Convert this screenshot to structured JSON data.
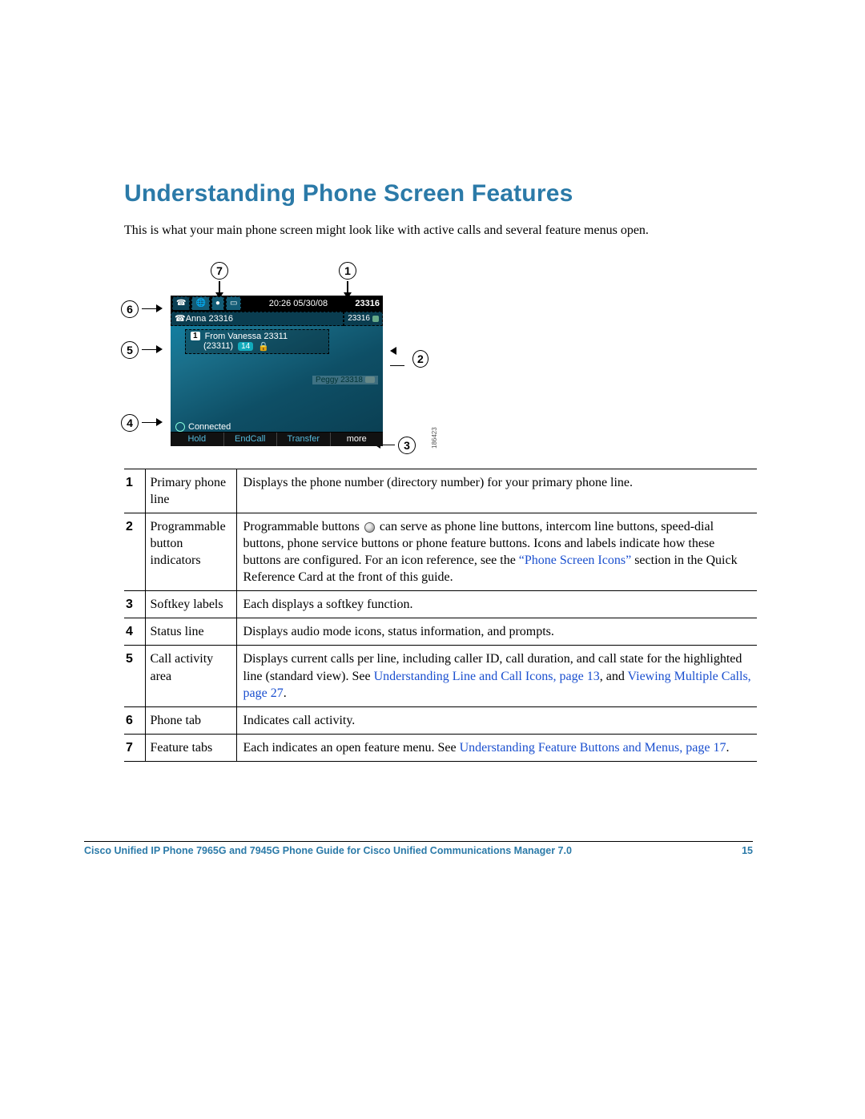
{
  "heading": "Understanding Phone Screen Features",
  "intro": "This is what your main phone screen might look like with active calls and several feature menus open.",
  "diagram": {
    "callouts": [
      "1",
      "2",
      "3",
      "4",
      "5",
      "6",
      "7"
    ],
    "image_number": "186423",
    "phone": {
      "time_date": "20:26 05/30/08",
      "primary_number": "23316",
      "left_tab_icons": [
        "phone-icon",
        "world-icon",
        "orb-icon"
      ],
      "line_label": "Anna 23316",
      "prog_button_label": "23316",
      "call": {
        "index": "1",
        "from_text": "From Vanessa 23311",
        "sub_number": "(23311)",
        "duration": "14"
      },
      "peggy": "Peggy 23318",
      "status": "Connected",
      "softkeys": [
        "Hold",
        "EndCall",
        "Transfer",
        "more"
      ]
    }
  },
  "table": [
    {
      "n": "1",
      "label": "Primary phone line",
      "desc": {
        "plain": "Displays the phone number (directory number) for your primary phone line."
      }
    },
    {
      "n": "2",
      "label": "Programmable button indicators",
      "desc": {
        "prefix": "Programmable buttons ",
        "button_icon": true,
        "mid": " can serve as phone line buttons, intercom line buttons, speed-dial buttons, phone service buttons or phone feature buttons. Icons and labels indicate how these buttons are configured. For an icon reference, see the ",
        "xref_quoted": "“Phone Screen Icons”",
        "suffix": " section in the Quick Reference Card at the front of this guide."
      }
    },
    {
      "n": "3",
      "label": "Softkey labels",
      "desc": {
        "plain": "Each displays a softkey function."
      }
    },
    {
      "n": "4",
      "label": "Status line",
      "desc": {
        "plain": "Displays audio mode icons, status information, and prompts."
      }
    },
    {
      "n": "5",
      "label": "Call activity area",
      "desc": {
        "prefix": "Displays current calls per line, including caller ID, call duration, and call state for the highlighted line (standard view). See ",
        "xref1": "Understanding Line and Call Icons, page 13",
        "mid2": ", and ",
        "xref2": "Viewing Multiple Calls, page 27",
        "suffix2": "."
      }
    },
    {
      "n": "6",
      "label": "Phone tab",
      "desc": {
        "plain": "Indicates call activity."
      }
    },
    {
      "n": "7",
      "label": "Feature tabs",
      "desc": {
        "prefix": "Each indicates an open feature menu. See ",
        "xref1": "Understanding Feature Buttons and Menus, page 17",
        "suffix2": "."
      }
    }
  ],
  "footer": {
    "title": "Cisco Unified IP Phone 7965G and 7945G Phone Guide for Cisco Unified Communications Manager 7.0",
    "page": "15"
  }
}
